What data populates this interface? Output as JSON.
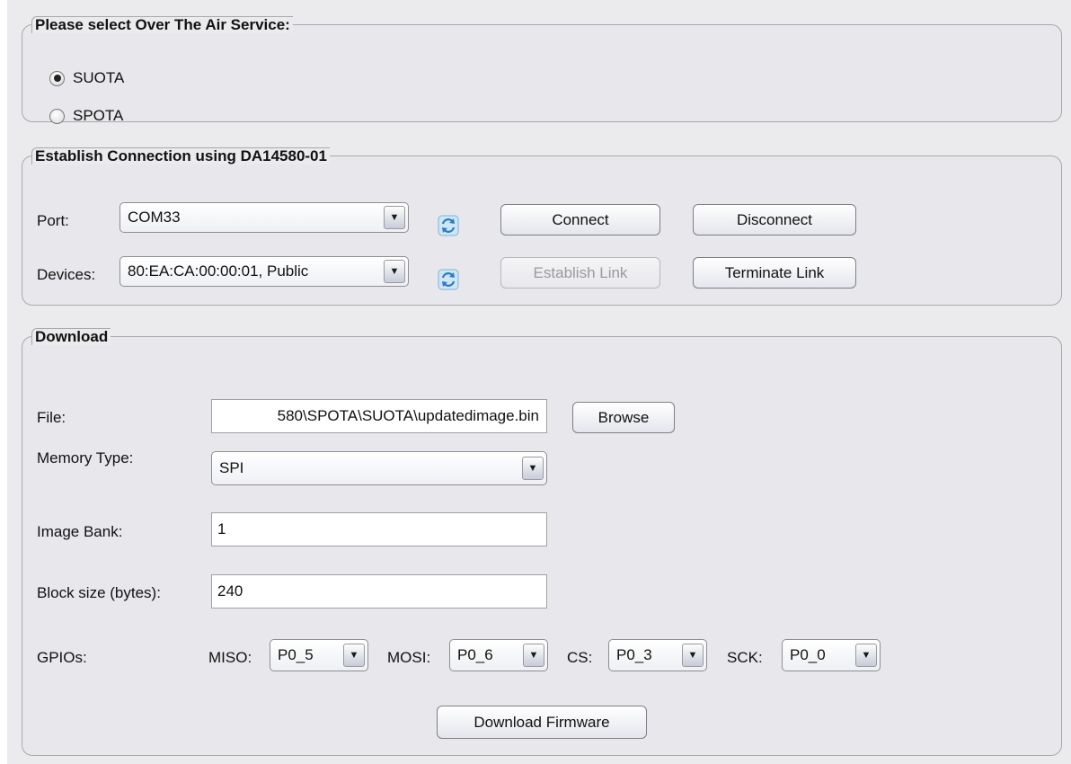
{
  "ota": {
    "legend": "Please select Over The Air Service:",
    "options": [
      {
        "label": "SUOTA",
        "selected": true
      },
      {
        "label": "SPOTA",
        "selected": false
      }
    ]
  },
  "connection": {
    "legend": "Establish Connection using DA14580-01",
    "port_label": "Port:",
    "port_value": "COM33",
    "devices_label": "Devices:",
    "devices_value": "80:EA:CA:00:00:01, Public",
    "refresh_icon": "refresh-icon",
    "connect": "Connect",
    "disconnect": "Disconnect",
    "establish_link": "Establish Link",
    "terminate_link": "Terminate Link"
  },
  "download": {
    "legend": "Download",
    "file_label": "File:",
    "file_value": "580\\SPOTA\\SUOTA\\updatedimage.bin",
    "browse": "Browse",
    "memory_label": "Memory Type:",
    "memory_value": "SPI",
    "bank_label": "Image Bank:",
    "bank_value": "1",
    "block_label": "Block size (bytes):",
    "block_value": "240",
    "gpios_label": "GPIOs:",
    "gpios": [
      {
        "label": "MISO:",
        "value": "P0_5"
      },
      {
        "label": "MOSI:",
        "value": "P0_6"
      },
      {
        "label": "CS:",
        "value": "P0_3"
      },
      {
        "label": "SCK:",
        "value": "P0_0"
      }
    ],
    "download_button": "Download Firmware"
  }
}
